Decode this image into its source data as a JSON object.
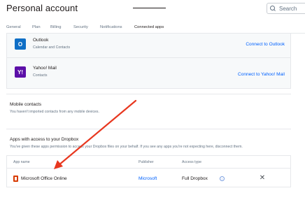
{
  "header": {
    "title": "Personal account",
    "search_placeholder": "Search"
  },
  "tabs": [
    {
      "label": "General",
      "active": false
    },
    {
      "label": "Plan",
      "active": false
    },
    {
      "label": "Billing",
      "active": false
    },
    {
      "label": "Security",
      "active": false
    },
    {
      "label": "Notifications",
      "active": false
    },
    {
      "label": "Connected apps",
      "active": true
    }
  ],
  "available_apps": [
    {
      "name": "Outlook",
      "description": "Calendar and Contacts",
      "action": "Connect to Outlook",
      "icon": "outlook-icon",
      "logo_text": "O"
    },
    {
      "name": "Yahoo! Mail",
      "description": "Contacts",
      "action": "Connect to Yahoo! Mail",
      "icon": "yahoo-mail-icon",
      "logo_text": "Y!"
    }
  ],
  "mobile_contacts": {
    "title": "Mobile contacts",
    "description": "You haven't imported contacts from any mobile devices."
  },
  "apps_access": {
    "title": "Apps with access to your Dropbox",
    "description": "You've given these apps permission to access your Dropbox files on your behalf. If you see any apps you're not expecting here, disconnect them.",
    "columns": {
      "app_name": "App name",
      "publisher": "Publisher",
      "access_type": "Access type"
    },
    "rows": [
      {
        "app_name": "Microsoft Office Online",
        "publisher": "Microsoft",
        "access_type": "Full Dropbox",
        "icon": "microsoft-office-icon"
      }
    ]
  },
  "colors": {
    "link": "#0061fe",
    "annotation_arrow": "#e8371f"
  }
}
